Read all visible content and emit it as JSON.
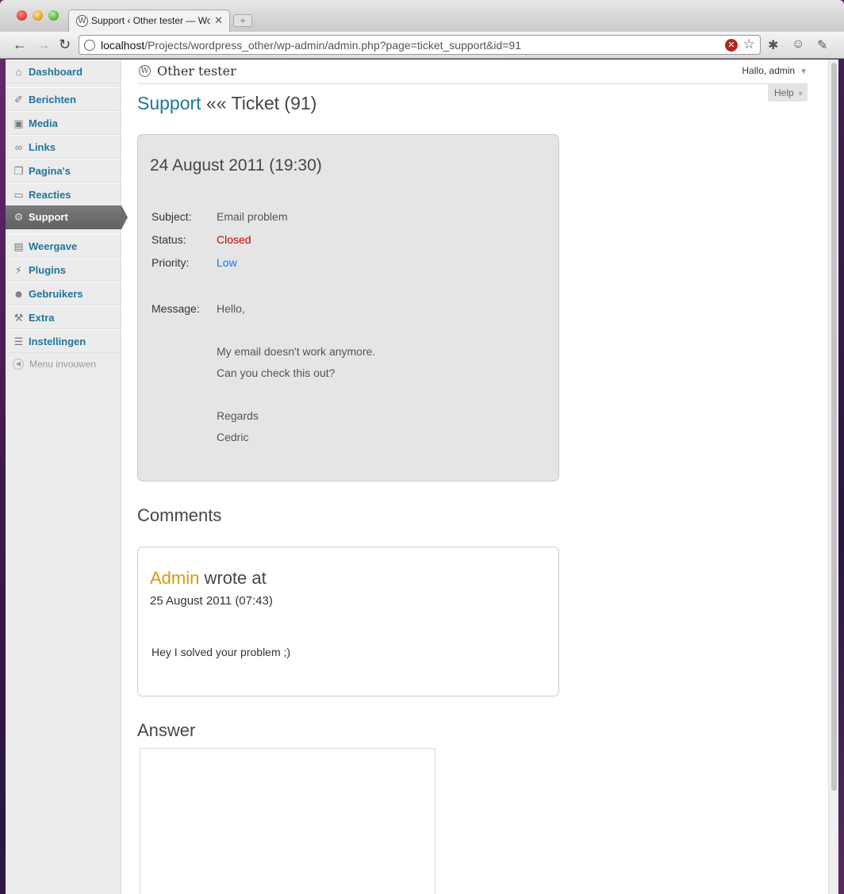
{
  "browser": {
    "tab_title": "Support ‹ Other tester — WordPress",
    "url_host": "localhost",
    "url_path": "/Projects/wordpress_other/wp-admin/admin.php?page=ticket_support&id=91"
  },
  "sidebar": {
    "items": [
      {
        "label": "Dashboard",
        "icon": "home-icon"
      },
      {
        "label": "Berichten",
        "icon": "pin-icon"
      },
      {
        "label": "Media",
        "icon": "media-icon"
      },
      {
        "label": "Links",
        "icon": "link-icon"
      },
      {
        "label": "Pagina's",
        "icon": "pages-icon"
      },
      {
        "label": "Reacties",
        "icon": "comments-icon"
      },
      {
        "label": "Support",
        "icon": "gear-icon",
        "active": true
      },
      {
        "label": "Weergave",
        "icon": "appearance-icon"
      },
      {
        "label": "Plugins",
        "icon": "plugin-icon"
      },
      {
        "label": "Gebruikers",
        "icon": "users-icon"
      },
      {
        "label": "Extra",
        "icon": "tools-icon"
      },
      {
        "label": "Instellingen",
        "icon": "settings-icon"
      }
    ],
    "collapse_label": "Menu invouwen"
  },
  "header": {
    "site_name": "Other tester",
    "howdy": "Hallo, admin",
    "help": "Help"
  },
  "page": {
    "title_link": "Support",
    "title_sep": "««",
    "title_rest": "Ticket (91)"
  },
  "ticket": {
    "date": "24 August 2011 (19:30)",
    "subject_label": "Subject:",
    "subject": "Email problem",
    "status_label": "Status:",
    "status": "Closed",
    "priority_label": "Priority:",
    "priority": "Low",
    "message_label": "Message:",
    "message_lines": [
      "Hello,",
      "My email doesn't work anymore.",
      "Can you check this out?",
      "Regards",
      "Cedric"
    ]
  },
  "comments": {
    "title": "Comments",
    "items": [
      {
        "author": "Admin",
        "wrote": "wrote at",
        "date": "25 August 2011 (07:43)",
        "text": "Hey I solved your problem ;)"
      }
    ]
  },
  "answer": {
    "title": "Answer",
    "value": ""
  },
  "colors": {
    "link": "#21759b",
    "closed": "#cc0000",
    "low": "#1a73e8",
    "author": "#d59b0b"
  }
}
